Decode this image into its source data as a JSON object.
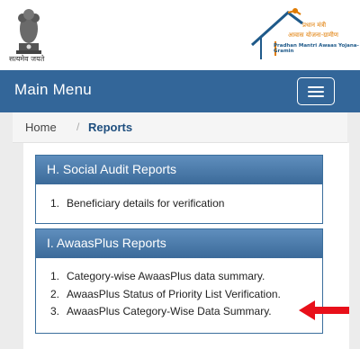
{
  "header": {
    "emblem_caption": "सत्यमेव जयते",
    "pmay_hindi_1": "प्रधान मंत्री",
    "pmay_hindi_2": "आवास योजना-ग्रामीण",
    "pmay_english": "Pradhan Mantri Awaas Yojana-Gramin"
  },
  "navbar": {
    "title": "Main Menu",
    "toggle_icon": "hamburger-icon"
  },
  "breadcrumb": {
    "home": "Home",
    "separator": "/",
    "current": "Reports"
  },
  "sections": [
    {
      "title": "H. Social Audit Reports",
      "items": [
        {
          "num": "1.",
          "label": "Beneficiary details for verification"
        }
      ]
    },
    {
      "title": "I. AwaasPlus Reports",
      "items": [
        {
          "num": "1.",
          "label": "Category-wise AwaasPlus data summary."
        },
        {
          "num": "2.",
          "label": "AwaasPlus Status of Priority List Verification."
        },
        {
          "num": "3.",
          "label": "AwaasPlus Category-Wise Data Summary."
        }
      ]
    }
  ],
  "colors": {
    "navbar": "#336699",
    "panel_heading": "#4a7aaa",
    "breadcrumb_active": "#1f4f7f",
    "arrow": "#e8101a"
  }
}
